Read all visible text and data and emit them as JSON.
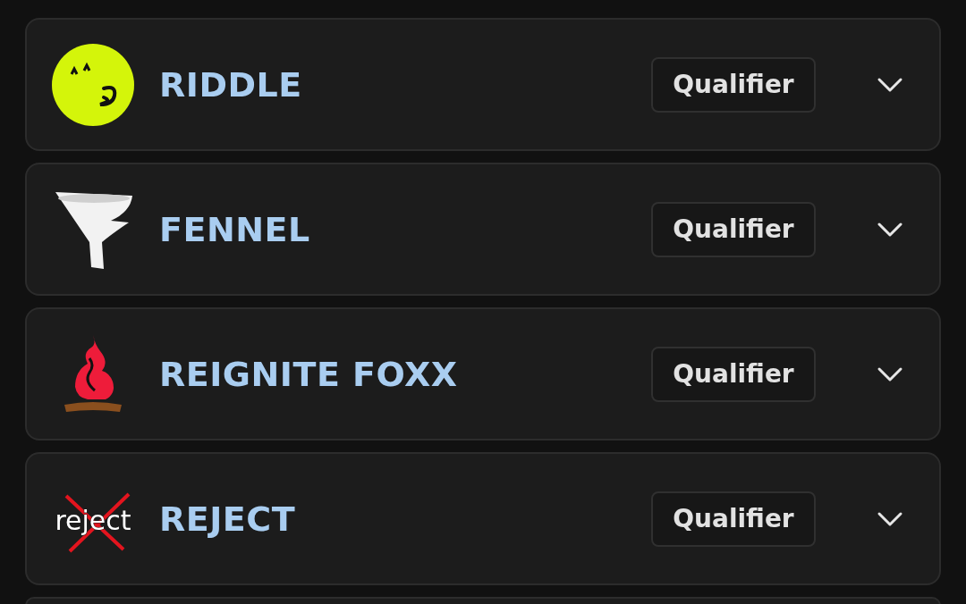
{
  "teams": [
    {
      "name": "RIDDLE",
      "kind": "smiley",
      "badge": "Qualifier",
      "expanded": false
    },
    {
      "name": "FENNEL",
      "kind": "funnel",
      "badge": "Qualifier",
      "expanded": false
    },
    {
      "name": "REIGNITE FOXX",
      "kind": "flame",
      "badge": "Qualifier",
      "expanded": false
    },
    {
      "name": "REJECT",
      "kind": "crossed",
      "logo_text": "reject",
      "badge": "Qualifier",
      "expanded": false
    }
  ],
  "more_below": true
}
